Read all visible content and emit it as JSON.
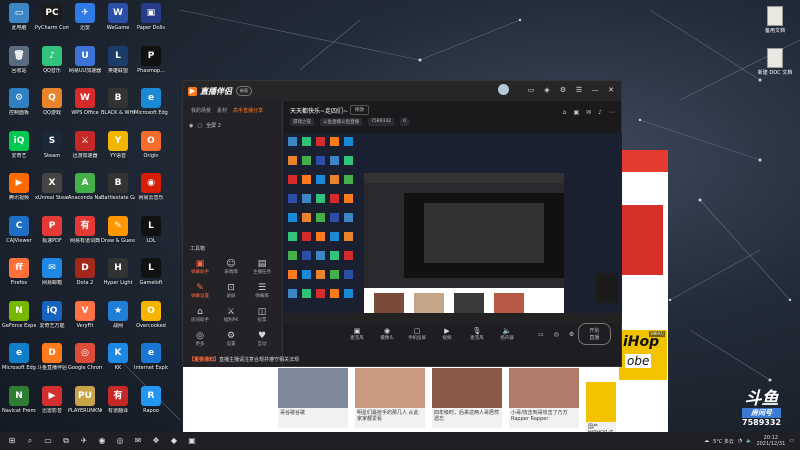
{
  "desktop": {
    "icons": [
      {
        "label": "此电脑",
        "glyph": "▭",
        "color": "#3d86c6"
      },
      {
        "label": "PyCharm Commun...",
        "glyph": "PC",
        "color": "#1c1c1c"
      },
      {
        "label": "迅雷",
        "glyph": "✈",
        "color": "#2d7be5"
      },
      {
        "label": "WeGame",
        "glyph": "W",
        "color": "#2b4ea6"
      },
      {
        "label": "Paper Dolls",
        "glyph": "▣",
        "color": "#273c88"
      },
      {
        "label": "回收站",
        "glyph": "🗑",
        "color": "#5a6b80"
      },
      {
        "label": "QQ音乐",
        "glyph": "♪",
        "color": "#31c27c"
      },
      {
        "label": "网易UU加速器",
        "glyph": "U",
        "color": "#3b73d6"
      },
      {
        "label": "英雄联盟",
        "glyph": "L",
        "color": "#1a3c68"
      },
      {
        "label": "Phasmop...",
        "glyph": "P",
        "color": "#111111"
      },
      {
        "label": "控制面板",
        "glyph": "⚙",
        "color": "#2f7fc1"
      },
      {
        "label": "QQ游戏",
        "glyph": "Q",
        "color": "#e9832b"
      },
      {
        "label": "WPS Office",
        "glyph": "W",
        "color": "#d62b2b"
      },
      {
        "label": "BLACK & WHITE",
        "glyph": "B",
        "color": "#333333"
      },
      {
        "label": "Microsoft Edge",
        "glyph": "e",
        "color": "#1a8ad6"
      },
      {
        "label": "爱奇艺",
        "glyph": "iQ",
        "color": "#00c853"
      },
      {
        "label": "Steam",
        "glyph": "S",
        "color": "#1b2838"
      },
      {
        "label": "迅游加速器",
        "glyph": "⚔",
        "color": "#c62828"
      },
      {
        "label": "YY语音",
        "glyph": "Y",
        "color": "#f2b600"
      },
      {
        "label": "Origin",
        "glyph": "O",
        "color": "#f56c2d"
      },
      {
        "label": "腾讯视频",
        "glyph": "▶",
        "color": "#ff6a00"
      },
      {
        "label": "xUnreal Steam",
        "glyph": "X",
        "color": "#444444"
      },
      {
        "label": "Anaconda Navigator",
        "glyph": "A",
        "color": "#43b049"
      },
      {
        "label": "Battlestate Games",
        "glyph": "B",
        "color": "#333333"
      },
      {
        "label": "网易云音乐",
        "glyph": "◉",
        "color": "#d81e06"
      },
      {
        "label": "CAJViewer",
        "glyph": "C",
        "color": "#1e6fc6"
      },
      {
        "label": "极速PDF",
        "glyph": "P",
        "color": "#e53935"
      },
      {
        "label": "网易有道词典",
        "glyph": "有",
        "color": "#e53935"
      },
      {
        "label": "Draw & Guess",
        "glyph": "✎",
        "color": "#ff9800"
      },
      {
        "label": "LOL",
        "glyph": "L",
        "color": "#111111"
      },
      {
        "label": "Firefox",
        "glyph": "ff",
        "color": "#ff7139"
      },
      {
        "label": "网易邮箱",
        "glyph": "✉",
        "color": "#1e88e5"
      },
      {
        "label": "Dota 2",
        "glyph": "D",
        "color": "#a3281c"
      },
      {
        "label": "Hyper Light",
        "glyph": "H",
        "color": "#333333"
      },
      {
        "label": "Gameloft",
        "glyph": "L",
        "color": "#111111"
      },
      {
        "label": "GeForce Experience",
        "glyph": "N",
        "color": "#76b900"
      },
      {
        "label": "爱奇艺万能",
        "glyph": "iQ",
        "color": "#1565c0"
      },
      {
        "label": "VeryFit",
        "glyph": "V",
        "color": "#ff7043"
      },
      {
        "label": "战网",
        "glyph": "★",
        "color": "#1d7fd6"
      },
      {
        "label": "Overcooked",
        "glyph": "O",
        "color": "#f4b400"
      },
      {
        "label": "Microsoft Edge",
        "glyph": "e",
        "color": "#0f7fc9"
      },
      {
        "label": "斗鱼直播伴侣",
        "glyph": "D",
        "color": "#ff7a1c"
      },
      {
        "label": "Google Chrome",
        "glyph": "◎",
        "color": "#dd4b39"
      },
      {
        "label": "KK",
        "glyph": "K",
        "color": "#1e88e5"
      },
      {
        "label": "Internet Explorer",
        "glyph": "e",
        "color": "#1976d2"
      },
      {
        "label": "Navicat Premium 12",
        "glyph": "N",
        "color": "#2e7d32"
      },
      {
        "label": "迅雷影音",
        "glyph": "▶",
        "color": "#d32f2f"
      },
      {
        "label": "PLAYERUNKNOWN'S",
        "glyph": "PU",
        "color": "#c8a34a"
      },
      {
        "label": "有道翻译",
        "glyph": "有",
        "color": "#c62828"
      },
      {
        "label": "Rapoo",
        "glyph": "R",
        "color": "#2196f3"
      }
    ],
    "right_icons": [
      {
        "label": "备用文档"
      },
      {
        "label": "新建 DOC 文档"
      }
    ]
  },
  "live_app": {
    "logo_name": "直播伴侣",
    "version": "新版",
    "left_tabs": [
      "我的场景",
      "素材",
      "高手直播分享"
    ],
    "scene_label": "全屏 2",
    "tools_title": "工具箱",
    "tools": [
      {
        "label": "弹幕助手",
        "glyph": "▣",
        "hot": true
      },
      {
        "label": "表情库",
        "glyph": "☺",
        "hot": false
      },
      {
        "label": "主播任务",
        "glyph": "▤",
        "hot": false
      },
      {
        "label": "弹幕设置",
        "glyph": "✎",
        "hot": true
      },
      {
        "label": "录屏",
        "glyph": "⊡",
        "hot": false
      },
      {
        "label": "弹幕库",
        "glyph": "☰",
        "hot": false
      },
      {
        "label": "房间助手",
        "glyph": "⌂",
        "hot": false
      },
      {
        "label": "福利PK",
        "glyph": "⚔",
        "hot": false
      },
      {
        "label": "投票",
        "glyph": "◫",
        "hot": false
      },
      {
        "label": "更多",
        "glyph": "◎",
        "hot": false
      },
      {
        "label": "设置",
        "glyph": "⚙",
        "hot": false
      },
      {
        "label": "互动",
        "glyph": "♥",
        "hot": false
      }
    ],
    "notice": {
      "tag": "【重要通知】",
      "text": "直播主播请注意合规并遵守相关法规"
    },
    "stream_title": "天天都快乐~走四们~",
    "edit_label": "修改",
    "meta": [
      "游戏之夜",
      "斗鱼直播斗鱼直播",
      "7589332"
    ],
    "watch_count": "0",
    "input_buttons": [
      {
        "label": "麦克风",
        "glyph": "▣"
      },
      {
        "label": "摄像头",
        "glyph": "◉"
      },
      {
        "label": "手机投屏",
        "glyph": "▢"
      },
      {
        "label": "视频",
        "glyph": "▶"
      },
      {
        "label": "麦克风",
        "glyph": "🎙"
      },
      {
        "label": "扬声器",
        "glyph": "🔈"
      }
    ],
    "start_label": "开始直播"
  },
  "background_browser": {
    "cards": [
      "哥谷歌谷歌",
      "明星们最抢手的那几人 从此家家都爱看",
      "四年级时，后来这两人哥居然遗忘",
      "小哥/攻击到哥攻击了乃万Rapper Rapper",
      "国产HIPHOP 这一个世界都是它"
    ],
    "hiphop_text": "iHop",
    "hiphop_sub": "obe",
    "hot_label": "1869万"
  },
  "overlay": {
    "brand": "斗鱼",
    "sub": "房间号",
    "room": "7589332"
  },
  "taskbar": {
    "apps": [
      "⊞",
      "⌕",
      "▭",
      "⧉",
      "✈",
      "◉",
      "◎",
      "✉",
      "❖",
      "◆",
      "▣"
    ],
    "weather": "5°C 多云",
    "time": "20:12",
    "date": "2021/12/31"
  }
}
